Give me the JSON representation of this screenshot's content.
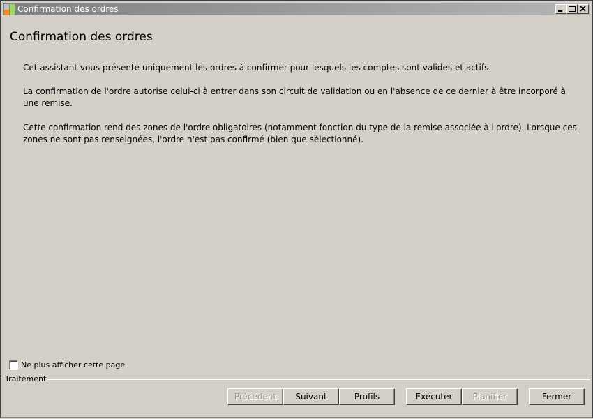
{
  "window": {
    "title": "Confirmation des ordres"
  },
  "page": {
    "heading": "Confirmation des ordres",
    "paragraphs": [
      "Cet assistant vous présente uniquement les ordres à confirmer pour lesquels les comptes sont valides et actifs.",
      "La confirmation de l'ordre autorise celui-ci à entrer dans son circuit de validation ou en l'absence de ce dernier à être incorporé à une remise.",
      "Cette confirmation rend des zones de l'ordre obligatoires (notamment fonction du type de la remise associée à l'ordre). Lorsque ces zones ne sont pas renseignées, l'ordre n'est pas confirmé (bien que sélectionné)."
    ]
  },
  "options": {
    "dont_show_label": "Ne plus afficher cette page",
    "dont_show_checked": false
  },
  "group": {
    "label": "Traitement"
  },
  "buttons": {
    "previous": "Précédent",
    "next": "Suivant",
    "profiles": "Profils",
    "execute": "Exécuter",
    "schedule": "Planifier",
    "close": "Fermer"
  },
  "colors": {
    "window_bg": "#d4d0c8",
    "titlebar_start": "#808080",
    "titlebar_end": "#b5b5b5",
    "disabled_text": "#9a968f"
  },
  "icons": {
    "app": "app-icon",
    "minimize": "minimize-icon",
    "maximize": "maximize-icon",
    "close": "close-icon"
  }
}
